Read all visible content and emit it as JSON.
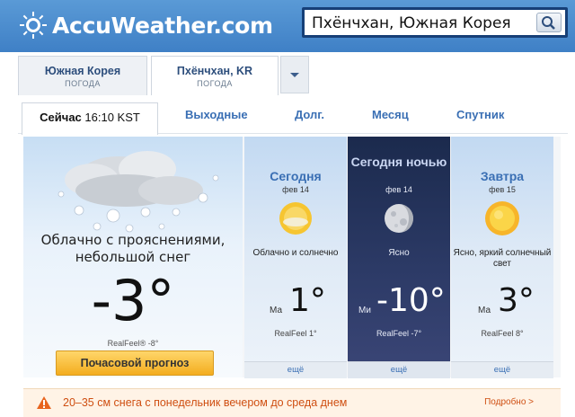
{
  "header": {
    "logo_text": "AccuWeather.com",
    "search_value": "Пхёнчхан, Южная Корея"
  },
  "location_tabs": [
    {
      "title": "Южная Корея",
      "subtitle": "ПОГОДА"
    },
    {
      "title": "Пхёнчхан, KR",
      "subtitle": "ПОГОДА"
    }
  ],
  "nav": {
    "now_label": "Сейчас",
    "now_time": "16:10 KST",
    "items": [
      "Выходные",
      "Долг.",
      "Месяц",
      "Спутник"
    ]
  },
  "current": {
    "condition": "Облачно с прояснениями, небольшой снег",
    "temp": "-3°",
    "realfeel": "RealFeel® -8°",
    "hourly_button": "Почасовой прогноз",
    "icon": "cloud-sun-snow-icon"
  },
  "forecast": [
    {
      "title": "Сегодня",
      "date": "фев 14",
      "condition": "Облачно и солнечно",
      "ma_label": "Ма",
      "temp": "1°",
      "realfeel": "RealFeel 1°",
      "more": "ещё",
      "icon": "sun-cloud-icon",
      "theme": "day"
    },
    {
      "title": "Сегодня ночью",
      "date": "фев 14",
      "condition": "Ясно",
      "ma_label": "Ми",
      "temp": "-10°",
      "realfeel": "RealFeel -7°",
      "more": "ещё",
      "icon": "moon-icon",
      "theme": "night"
    },
    {
      "title": "Завтра",
      "date": "фев 15",
      "condition": "Ясно, яркий солнечный свет",
      "ma_label": "Ма",
      "temp": "3°",
      "realfeel": "RealFeel 8°",
      "more": "ещё",
      "icon": "sun-icon",
      "theme": "day"
    }
  ],
  "alert": {
    "text": "20–35 см снега с понедельник вечером до среда днем",
    "more": "Подробно >"
  },
  "colors": {
    "header_blue": "#4a8bd0",
    "search_border": "#163f77",
    "link_blue": "#3a6fb4",
    "button_orange": "#f3ad1f",
    "alert_orange": "#cf4f12"
  }
}
